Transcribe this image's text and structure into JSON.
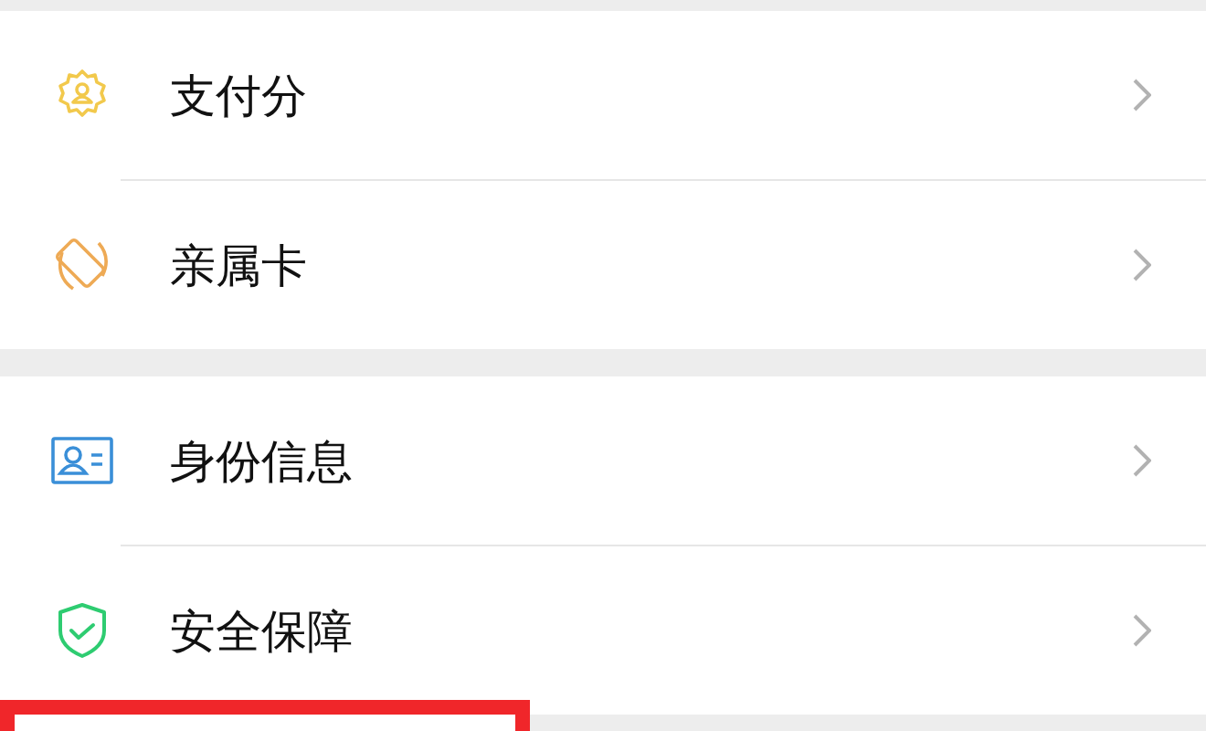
{
  "groups": [
    {
      "items": [
        {
          "kind": "score",
          "label": "支付分"
        },
        {
          "kind": "family-card",
          "label": "亲属卡"
        }
      ]
    },
    {
      "items": [
        {
          "kind": "id",
          "label": "身份信息"
        },
        {
          "kind": "security",
          "label": "安全保障"
        }
      ]
    }
  ]
}
